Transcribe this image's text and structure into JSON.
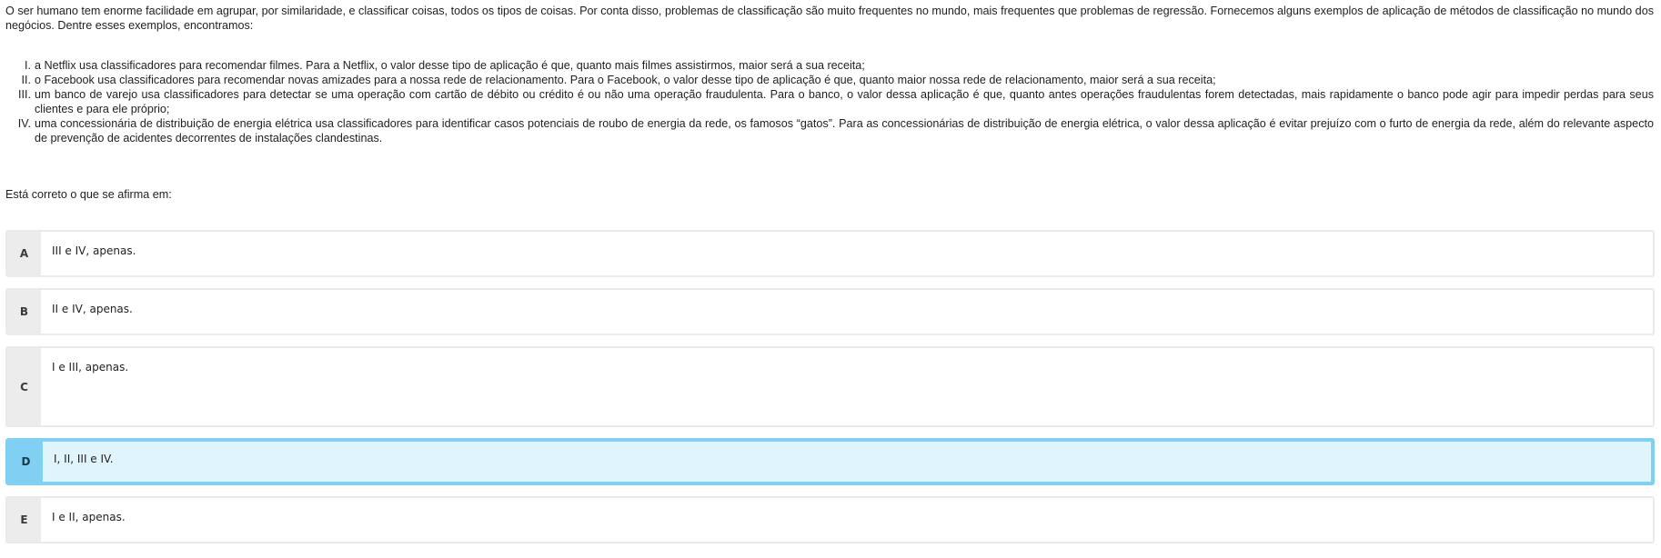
{
  "question": {
    "intro": "O ser humano tem enorme facilidade em agrupar, por similaridade, e classificar coisas, todos os tipos de coisas. Por conta disso, problemas de classificação são muito frequentes no mundo, mais frequentes que problemas de regressão. Fornecemos alguns exemplos de aplicação de métodos de classificação no mundo dos negócios. Dentre esses exemplos, encontramos:",
    "statements": [
      {
        "num": "I.",
        "text": "a Netflix usa classificadores para recomendar filmes. Para a Netflix, o valor desse tipo de aplicação é que, quanto mais filmes assistirmos, maior será a sua receita;"
      },
      {
        "num": "II.",
        "text": "o Facebook usa classificadores para recomendar novas amizades para a nossa rede de relacionamento. Para o Facebook, o valor desse tipo de aplicação é que, quanto maior nossa rede de relacionamento, maior será a sua receita;"
      },
      {
        "num": "III.",
        "text": "um banco de varejo usa classificadores para detectar se uma operação com cartão de débito ou crédito é ou não uma operação fraudulenta. Para o banco, o valor dessa aplicação é que, quanto antes operações fraudulentas forem detectadas, mais rapidamente o banco pode agir para impedir perdas para seus clientes e para ele próprio;"
      },
      {
        "num": "IV.",
        "text": "uma concessionária de distribuição de energia elétrica usa classificadores para identificar casos potenciais de roubo de energia da rede, os famosos “gatos”. Para as concessionárias de distribuição de energia elétrica, o valor dessa aplicação é evitar prejuízo com o furto de energia da rede, além do relevante aspecto de prevenção de acidentes decorrentes de instalações clandestinas."
      }
    ],
    "prompt": "Está correto o que se afirma em:"
  },
  "options": [
    {
      "letter": "A",
      "text": "III e IV, apenas."
    },
    {
      "letter": "B",
      "text": "II e IV, apenas."
    },
    {
      "letter": "C",
      "text": "I e III, apenas."
    },
    {
      "letter": "D",
      "text": "I, II, III e IV."
    },
    {
      "letter": "E",
      "text": "I e II, apenas."
    }
  ],
  "selected_option": "D",
  "colors": {
    "selected_border": "#7fd0f3",
    "selected_background": "#e0f4fc",
    "letter_background": "#ececec",
    "option_border": "#eaeaea"
  }
}
